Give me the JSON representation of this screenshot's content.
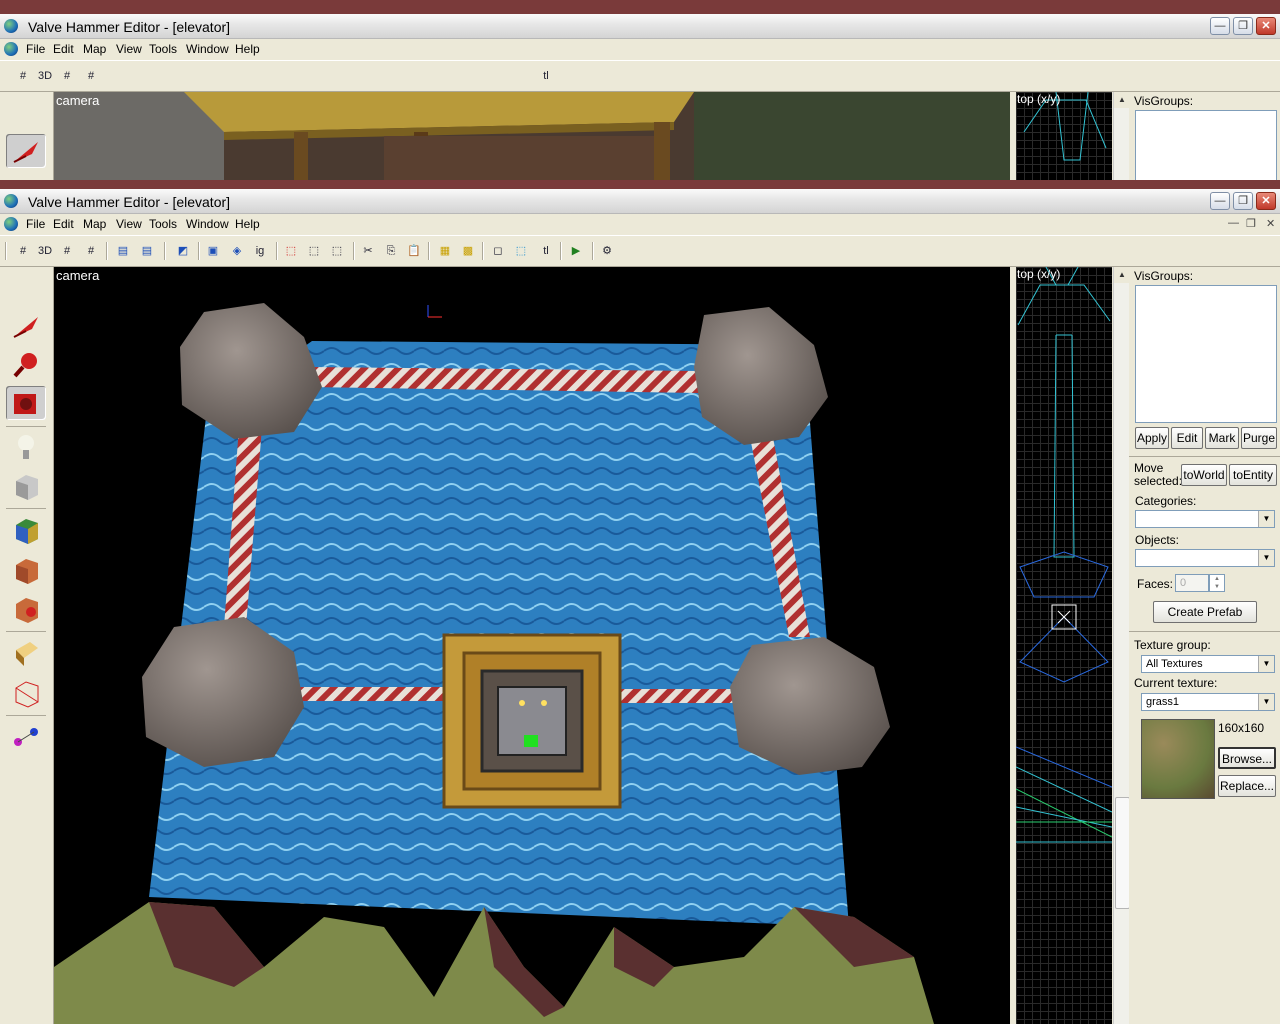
{
  "window": {
    "title": "Valve Hammer Editor - [elevator]",
    "minimize_glyph": "—",
    "restore_glyph": "❐",
    "close_glyph": "✕"
  },
  "menu": [
    "File",
    "Edit",
    "Map",
    "View",
    "Tools",
    "Window",
    "Help"
  ],
  "toolbar": {
    "grid_3d_label": "3D",
    "texture_lock_label": "tl",
    "ignore_groups_label": "ig"
  },
  "camera_view": {
    "label": "camera"
  },
  "top_view": {
    "label": "top (x/y)"
  },
  "visgroups": {
    "label": "VisGroups:",
    "apply": "Apply",
    "edit": "Edit",
    "mark": "Mark",
    "purge": "Purge"
  },
  "move_selected": {
    "label": "Move selected:",
    "to_world": "toWorld",
    "to_entity": "toEntity"
  },
  "categories": {
    "label": "Categories:",
    "value": ""
  },
  "objects": {
    "label": "Objects:",
    "value": ""
  },
  "faces": {
    "label": "Faces:",
    "value": "0"
  },
  "create_prefab": "Create Prefab",
  "texture": {
    "group_label": "Texture group:",
    "group_value": "All Textures",
    "current_label": "Current texture:",
    "current_value": "grass1",
    "size": "160x160",
    "browse": "Browse...",
    "replace": "Replace..."
  },
  "tool_icons": [
    "selection-tool-icon",
    "magnify-tool-icon",
    "camera-tool-icon",
    "entity-tool-icon",
    "block-tool-icon",
    "texture-application-icon",
    "apply-current-texture-icon",
    "decal-tool-icon",
    "clipping-tool-icon",
    "vertex-manipulation-icon",
    "path-tool-icon"
  ],
  "colors": {
    "xp_face": "#ece9d8",
    "water": "#2d7fc0",
    "rock": "#7f7672",
    "crate": "#c49a3a",
    "grass": "#7e8a4a",
    "rope_red": "#b03030"
  }
}
